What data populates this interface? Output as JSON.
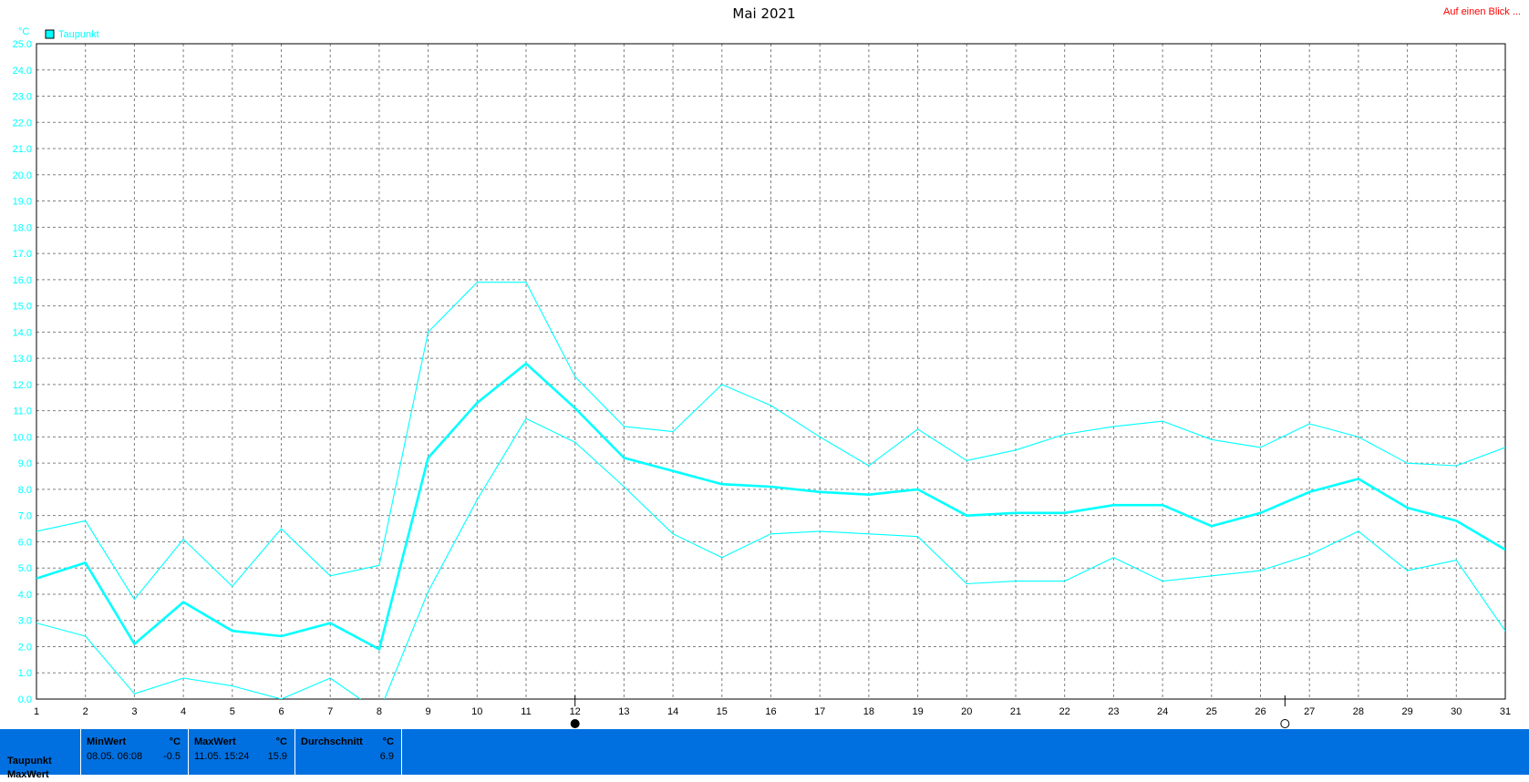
{
  "header": {
    "title": "Mai 2021",
    "link_label": "Auf einen Blick ..."
  },
  "colors": {
    "series": "#00ffff",
    "grid": "#808080",
    "stats_bg": "#0070e0",
    "link": "#ff0000"
  },
  "chart_data": {
    "type": "line",
    "title": "Mai 2021",
    "ylabel": "°C",
    "xlabel": "",
    "ylim": [
      0,
      25
    ],
    "ytick_step": 1,
    "grid": true,
    "legend": {
      "placement": "top-left",
      "entries": [
        "Taupunkt"
      ]
    },
    "x": [
      1,
      2,
      3,
      4,
      5,
      6,
      7,
      8,
      9,
      10,
      11,
      12,
      13,
      14,
      15,
      16,
      17,
      18,
      19,
      20,
      21,
      22,
      23,
      24,
      25,
      26,
      27,
      28,
      29,
      30,
      31
    ],
    "series": [
      {
        "name": "Taupunkt",
        "role": "average",
        "values": [
          4.6,
          5.2,
          2.1,
          3.7,
          2.6,
          2.4,
          2.9,
          1.9,
          9.2,
          11.3,
          12.8,
          11.1,
          9.2,
          8.7,
          8.2,
          8.1,
          7.9,
          7.8,
          8.0,
          7.0,
          7.1,
          7.1,
          7.4,
          7.4,
          6.6,
          7.1,
          7.9,
          8.4,
          7.3,
          6.8,
          5.7
        ]
      },
      {
        "role": "max",
        "values": [
          6.4,
          6.8,
          3.8,
          6.1,
          4.3,
          6.5,
          4.7,
          5.1,
          14.0,
          15.9,
          15.9,
          12.3,
          10.4,
          10.2,
          12.0,
          11.2,
          10.0,
          8.9,
          10.3,
          9.1,
          9.5,
          10.1,
          10.4,
          10.6,
          9.9,
          9.6,
          10.5,
          10.0,
          9.0,
          8.9,
          9.6
        ]
      },
      {
        "role": "min",
        "values": [
          2.9,
          2.4,
          0.2,
          0.8,
          0.5,
          0.0,
          0.8,
          -0.5,
          4.1,
          7.6,
          10.7,
          9.8,
          8.1,
          6.3,
          5.4,
          6.3,
          6.4,
          6.3,
          6.2,
          4.4,
          4.5,
          4.5,
          5.4,
          4.5,
          4.7,
          4.9,
          5.5,
          6.4,
          4.9,
          5.3,
          2.6
        ]
      }
    ],
    "markers": [
      {
        "day": 12,
        "symbol": "full-moon"
      },
      {
        "day": 26.5,
        "symbol": "new-moon"
      }
    ]
  },
  "stats": {
    "row_labels": [
      "Taupunkt",
      "MaxWert"
    ],
    "boxes": [
      {
        "head": "MinWert",
        "unit": "°C",
        "date": "08.05.  06:08",
        "value": "-0.5"
      },
      {
        "head": "MaxWert",
        "unit": "°C",
        "date": "11.05.  15:24",
        "value": "15.9"
      },
      {
        "head": "Durchschnitt",
        "unit": "°C",
        "date": "",
        "value": "6.9"
      }
    ]
  }
}
